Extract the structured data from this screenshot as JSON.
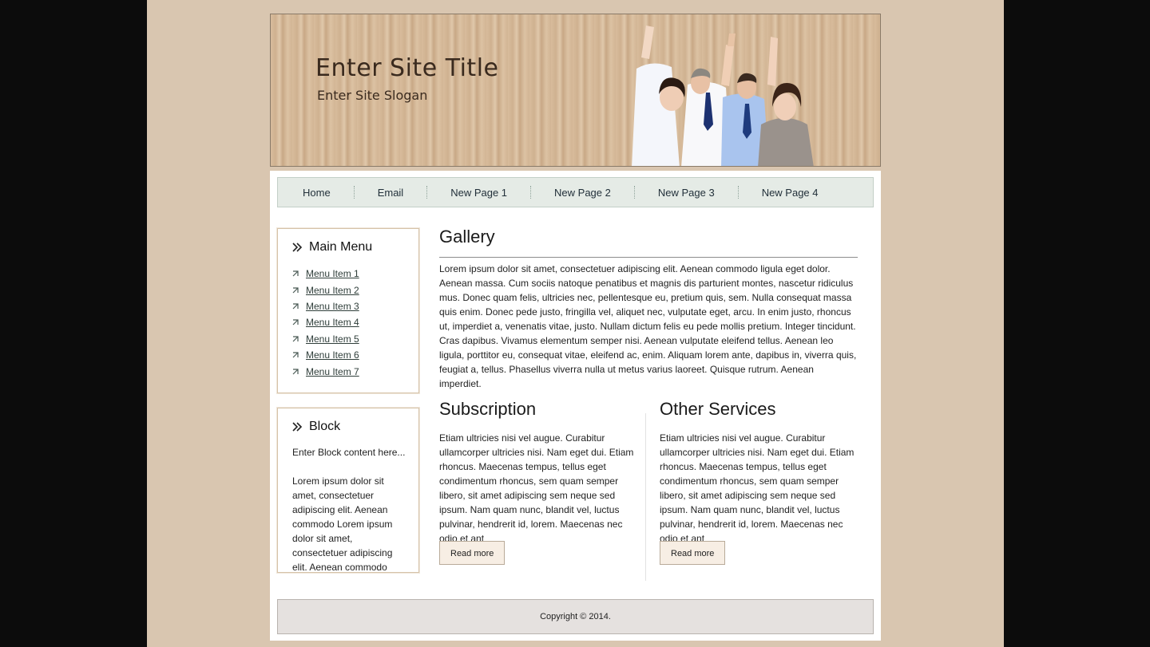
{
  "header": {
    "site_title": "Enter Site Title",
    "site_slogan": "Enter Site Slogan"
  },
  "nav": {
    "items": [
      "Home",
      "Email",
      "New Page 1",
      "New Page 2",
      "New Page 3",
      "New Page 4"
    ]
  },
  "main_menu": {
    "title": "Main Menu",
    "items": [
      "Menu Item 1",
      "Menu Item 2",
      "Menu Item 3",
      "Menu Item 4",
      "Menu Item 5",
      "Menu Item 6",
      "Menu Item 7"
    ]
  },
  "block": {
    "title": "Block",
    "intro": "Enter Block content here...",
    "text": "Lorem ipsum dolor sit amet, consectetuer adipiscing elit. Aenean commodo Lorem ipsum dolor sit amet, consectetuer adipiscing elit. Aenean commodo"
  },
  "gallery": {
    "heading": "Gallery",
    "text": "Lorem ipsum dolor sit amet, consectetuer adipiscing elit. Aenean commodo ligula eget dolor. Aenean massa. Cum sociis natoque penatibus et magnis dis parturient montes, nascetur ridiculus mus. Donec quam felis, ultricies nec, pellentesque eu, pretium quis, sem. Nulla consequat massa quis enim. Donec pede justo, fringilla vel, aliquet nec, vulputate eget, arcu. In enim justo, rhoncus ut, imperdiet a, venenatis vitae, justo. Nullam dictum felis eu pede mollis pretium. Integer tincidunt. Cras dapibus. Vivamus elementum semper nisi. Aenean vulputate eleifend tellus. Aenean leo ligula, porttitor eu, consequat vitae, eleifend ac, enim. Aliquam lorem ante, dapibus in, viverra quis, feugiat a, tellus. Phasellus viverra nulla ut metus varius laoreet. Quisque rutrum. Aenean imperdiet."
  },
  "subscription": {
    "heading": "Subscription",
    "text": "Etiam ultricies nisi vel augue. Curabitur ullamcorper ultricies nisi. Nam eget dui. Etiam rhoncus. Maecenas tempus, tellus eget condimentum rhoncus, sem quam semper libero, sit amet adipiscing sem neque sed ipsum. Nam quam nunc, blandit vel, luctus pulvinar, hendrerit id, lorem. Maecenas nec odio et ant",
    "button": "Read more"
  },
  "other_services": {
    "heading": "Other Services",
    "text": "Etiam ultricies nisi vel augue. Curabitur ullamcorper ultricies nisi. Nam eget dui. Etiam rhoncus. Maecenas tempus, tellus eget condimentum rhoncus, sem quam semper libero, sit amet adipiscing sem neque sed ipsum. Nam quam nunc, blandit vel, luctus pulvinar, hendrerit id, lorem. Maecenas nec odio et ant",
    "button": "Read more"
  },
  "footer": {
    "copyright": "Copyright © 2014."
  },
  "colors": {
    "outer_background": "#0c0c0c",
    "page_background": "#d9c6b0",
    "nav_background": "#e5ebe6",
    "button_background": "#f7eee4",
    "footer_background": "#e5e1df"
  },
  "icons": {
    "box_title": "double-chevron-right-icon",
    "menu_bullet": "small-arrow-icon"
  }
}
